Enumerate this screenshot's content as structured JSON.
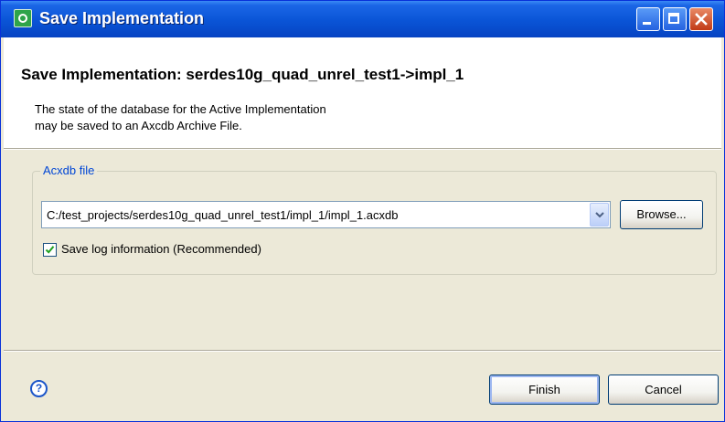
{
  "window": {
    "title": "Save Implementation"
  },
  "header": {
    "heading": "Save Implementation: serdes10g_quad_unrel_test1->impl_1",
    "description_line1": "The state of the database for the Active Implementation",
    "description_line2": "may be saved to an Axcdb Archive File."
  },
  "group": {
    "label": "Acxdb file",
    "file_path": "C:/test_projects/serdes10g_quad_unrel_test1/impl_1/impl_1.acxdb",
    "browse_label": "Browse...",
    "save_log_label": "Save log information (Recommended)",
    "save_log_checked": true
  },
  "footer": {
    "help_symbol": "?",
    "finish_label": "Finish",
    "cancel_label": "Cancel"
  },
  "colors": {
    "titlebar": "#0a54d6",
    "group_label": "#0046d5",
    "button_border": "#003c74"
  }
}
